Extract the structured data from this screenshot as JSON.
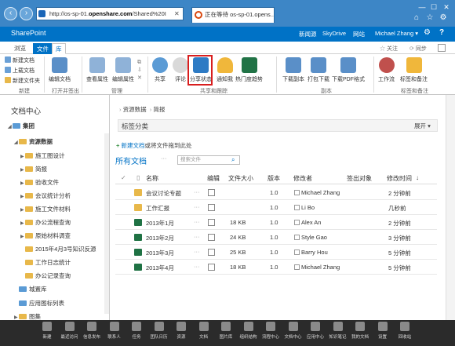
{
  "browser": {
    "url_prefix": "http://os-sp-01.",
    "url_domain": "openshare.com",
    "url_suffix": "/Shared%20I",
    "tab_title": "正在等待 os-sp-01.opens..."
  },
  "suite": {
    "brand": "SharePoint",
    "links": [
      "新闻源",
      "SkyDrive",
      "网站"
    ],
    "user": "Michael Zhang",
    "user_caret": "▾",
    "gear": "⚙",
    "help": "?"
  },
  "ribbon_tabs": [
    "浏览",
    "文件",
    "库"
  ],
  "ribbon_actions": {
    "follow": "关注",
    "sync": "同步"
  },
  "ribbon": {
    "new_small": [
      "新建文档",
      "上载文档",
      "新建文件夹"
    ],
    "buttons": [
      {
        "label": "编辑文档",
        "icon": "edit-doc-icon"
      },
      {
        "label": "查看属性",
        "icon": "view-props-icon"
      },
      {
        "label": "编辑属性",
        "icon": "edit-props-icon"
      },
      {
        "label": "共享",
        "icon": "share-icon"
      },
      {
        "label": "评论",
        "icon": "comment-icon"
      },
      {
        "label": "分享状态",
        "icon": "share-status-icon"
      },
      {
        "label": "通知我",
        "icon": "alert-bell-icon"
      },
      {
        "label": "热门度趋势",
        "icon": "popularity-trends-icon"
      },
      {
        "label": "下载副本",
        "icon": "download-copy-icon"
      },
      {
        "label": "打包下载",
        "icon": "zip-download-icon"
      },
      {
        "label": "下载PDF格式",
        "icon": "download-pdf-icon"
      },
      {
        "label": "工作流",
        "icon": "workflow-icon"
      },
      {
        "label": "标签和备注",
        "icon": "tags-notes-icon"
      }
    ],
    "groups": [
      "新建",
      "打开并签出",
      "管理",
      "共享和跟踪",
      "副本",
      "标签和备注"
    ]
  },
  "leftnav": {
    "title": "文档中心",
    "items": [
      {
        "label": "集团",
        "level": 0,
        "bold": true
      },
      {
        "label": "资源数据",
        "level": 1,
        "bold": true
      },
      {
        "label": "施工图设计",
        "level": 2
      },
      {
        "label": "简报",
        "level": 2
      },
      {
        "label": "验收文件",
        "level": 2
      },
      {
        "label": "会议统计分析",
        "level": 2
      },
      {
        "label": "施工文件材料",
        "level": 2
      },
      {
        "label": "办公流程查询",
        "level": 2
      },
      {
        "label": "原始材料调查",
        "level": 2
      },
      {
        "label": "2015年4月3号知识反源",
        "level": 2
      },
      {
        "label": "工作日志统计",
        "level": 2
      },
      {
        "label": "办公记录查询",
        "level": 2
      },
      {
        "label": "城置库",
        "level": 1
      },
      {
        "label": "应用图标列表",
        "level": 1
      },
      {
        "label": "图集",
        "level": 0
      }
    ]
  },
  "main": {
    "breadcrumb": [
      "资源数据",
      "简报"
    ],
    "breadcrumb_sep": "›",
    "tag_bar": "标签分类",
    "expand": "展开 ▾",
    "new_doc_link": "新建文档",
    "new_doc_rest": "或将文件拖到此处",
    "view_title": "所有文档",
    "view_more": "···",
    "search_placeholder": "搜索文件",
    "columns": [
      "名称",
      "编辑",
      "文件大小",
      "版本",
      "修改者",
      "签出对象",
      "修改时间"
    ],
    "sort_arrow": "↓",
    "rows": [
      {
        "name": "会议讨论专题",
        "type": "folder",
        "size": "",
        "version": "1.0",
        "editor": "Michael Zhang",
        "checkout": "",
        "modified": "2 分钟前"
      },
      {
        "name": "工作汇报",
        "type": "folder",
        "size": "",
        "version": "1.0",
        "editor": "Li Bo",
        "checkout": "",
        "modified": "几秒前"
      },
      {
        "name": "2013年1月",
        "type": "excel",
        "size": "18 KB",
        "version": "1.0",
        "editor": "Alex An",
        "checkout": "",
        "modified": "2 分钟前"
      },
      {
        "name": "2013年2月",
        "type": "excel",
        "size": "24 KB",
        "version": "1.0",
        "editor": "Style Gao",
        "checkout": "",
        "modified": "3 分钟前"
      },
      {
        "name": "2013年3月",
        "type": "excel",
        "size": "25 KB",
        "version": "1.0",
        "editor": "Barry Hou",
        "checkout": "",
        "modified": "5 分钟前"
      },
      {
        "name": "2013年4月",
        "type": "excel",
        "size": "18 KB",
        "version": "1.0",
        "editor": "Michael Zhang",
        "checkout": "",
        "modified": "5 分钟前"
      }
    ]
  },
  "taskbar": [
    "新建",
    "最近访问",
    "信息发布",
    "联系人",
    "任务",
    "团队日历",
    "资源",
    "文档",
    "图片库",
    "组织结构",
    "流程中心",
    "文档中心",
    "应用中心",
    "知识笔记",
    "我的文档",
    "设置",
    "回收站"
  ]
}
